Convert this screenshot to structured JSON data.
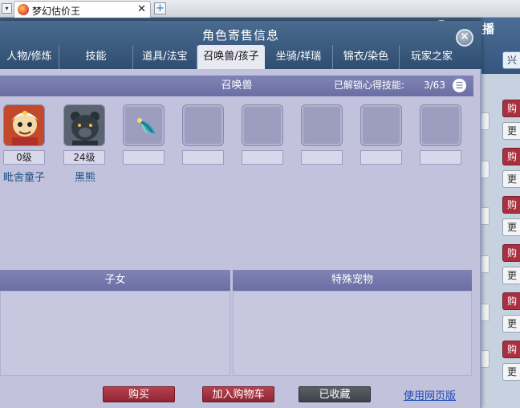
{
  "browser": {
    "menu_glyph": "▾",
    "tab_title": "梦幻估价王",
    "tab_close": "✕",
    "new_tab": "+"
  },
  "background": {
    "brand": "CC直播",
    "top_button": "兴",
    "red_button": "购",
    "white_button": "更"
  },
  "modal": {
    "title": "角色寄售信息",
    "close_glyph": "✕",
    "tabs": [
      "人物/修炼",
      "技能",
      "道具/法宝",
      "召唤兽/孩子",
      "坐骑/祥瑞",
      "锦衣/染色",
      "玩家之家"
    ],
    "active_tab": "召唤兽/孩子",
    "summon": {
      "title": "召唤兽",
      "skills_label": "已解锁心得技能:",
      "skills_count": "3/63",
      "pets": [
        {
          "level": "0级",
          "name": "毗舍童子"
        },
        {
          "level": "24级",
          "name": "黑熊"
        }
      ]
    },
    "children_title": "子女",
    "special_pets_title": "特殊宠物",
    "buttons": {
      "buy": "购买",
      "add_cart": "加入购物车",
      "collected": "已收藏",
      "web_version": "使用网页版"
    }
  },
  "colors": {
    "header": "#3b5a7e",
    "panel": "#c2c2dc",
    "section_bar": "#7478ac",
    "buy_red": "#a83040"
  }
}
